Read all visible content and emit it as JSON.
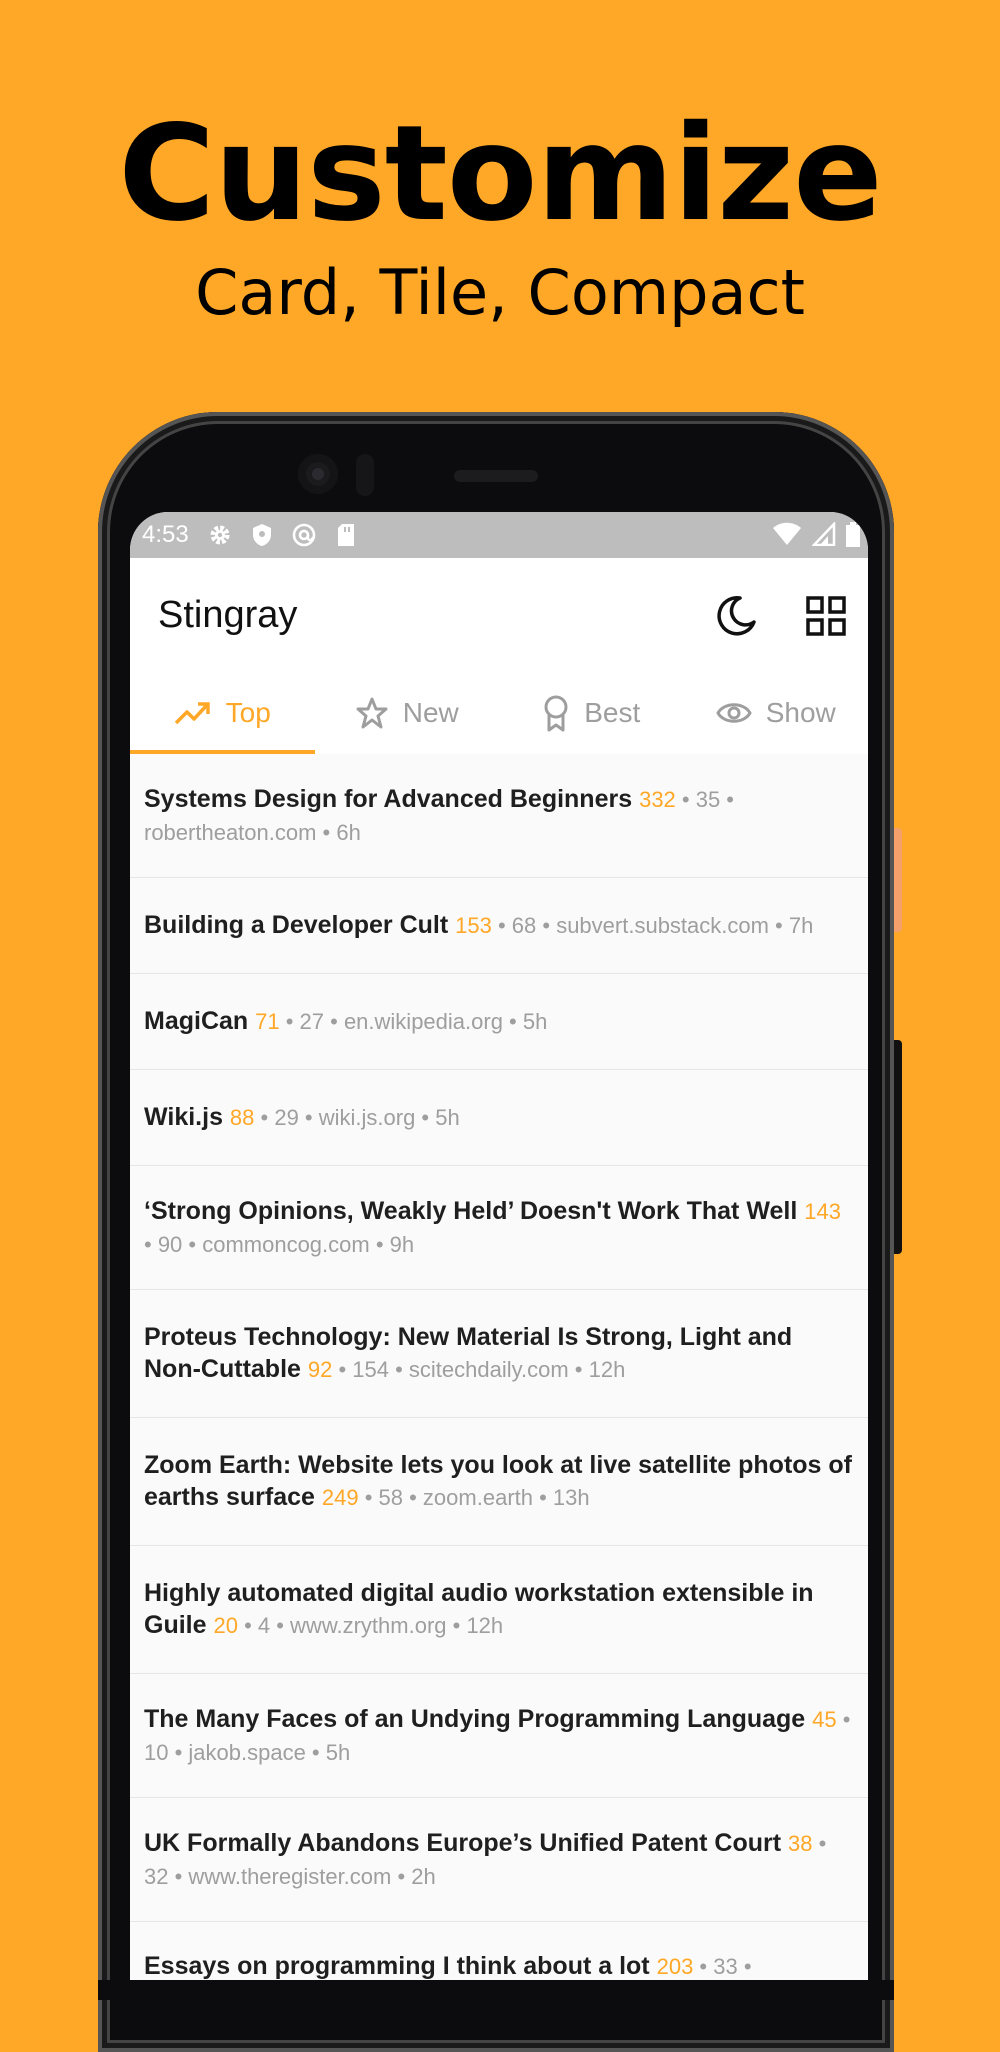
{
  "promo": {
    "title": "Customize",
    "subtitle": "Card, Tile, Compact"
  },
  "status_bar": {
    "time": "4:53",
    "icons": [
      "gear-icon",
      "shield-icon",
      "at-sign-icon",
      "sd-card-icon"
    ],
    "right_icons": [
      "wifi-icon",
      "signal-icon",
      "battery-icon"
    ]
  },
  "app_bar": {
    "title": "Stingray",
    "actions": [
      "dark-mode-moon-icon",
      "layout-grid-icon"
    ]
  },
  "tabs": [
    {
      "label": "Top",
      "icon": "trending-up-icon",
      "active": true
    },
    {
      "label": "New",
      "icon": "star-icon",
      "active": false
    },
    {
      "label": "Best",
      "icon": "award-ribbon-icon",
      "active": false
    },
    {
      "label": "Show",
      "icon": "eye-icon",
      "active": false
    }
  ],
  "stories": [
    {
      "title": "Systems Design for Advanced Beginners",
      "points": "332",
      "meta": " • 35 • robertheaton.com • 6h"
    },
    {
      "title": "Building a Developer Cult",
      "points": "153",
      "meta": " • 68 • subvert.substack.com • 7h"
    },
    {
      "title": "MagiCan",
      "points": "71",
      "meta": " • 27 • en.wikipedia.org • 5h"
    },
    {
      "title": "Wiki.js",
      "points": "88",
      "meta": " • 29 • wiki.js.org • 5h"
    },
    {
      "title": "‘Strong Opinions, Weakly Held’ Doesn't Work That Well",
      "points": "143",
      "meta": " • 90 • commoncog.com • 9h"
    },
    {
      "title": "Proteus Technology: New Material Is Strong, Light and Non-Cuttable",
      "points": "92",
      "meta": " • 154 • scitechdaily.com • 12h"
    },
    {
      "title": "Zoom Earth: Website lets you look at live satellite photos of earths surface",
      "points": "249",
      "meta": " • 58 • zoom.earth • 13h"
    },
    {
      "title": "Highly automated digital audio workstation extensible in Guile",
      "points": "20",
      "meta": " • 4 • www.zrythm.org • 12h"
    },
    {
      "title": "The Many Faces of an Undying Programming Language",
      "points": "45",
      "meta": " • 10 • jakob.space • 5h"
    },
    {
      "title": "UK Formally Abandons Europe’s Unified Patent Court",
      "points": "38",
      "meta": " • 32 • www.theregister.com • 2h"
    },
    {
      "title": "Essays on programming I think about a lot",
      "points": "203",
      "meta": " • 33 •"
    }
  ],
  "colors": {
    "accent": "#FFA726",
    "background": "#FFA726",
    "title_text": "#1f1f1f",
    "meta_text": "#9e9e9e"
  }
}
